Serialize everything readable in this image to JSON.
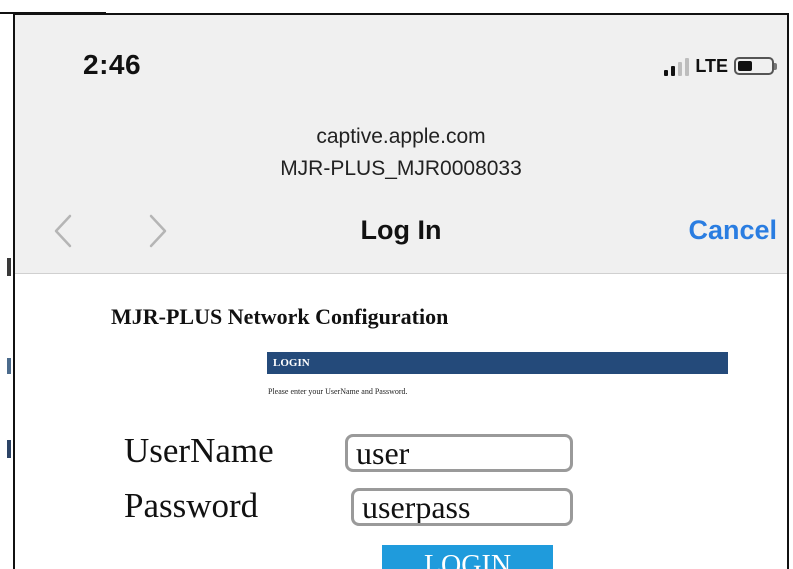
{
  "status_bar": {
    "time": "2:46",
    "network": "LTE",
    "signal_bars": 4,
    "signal_active": 2,
    "battery_level": 0.45
  },
  "browser": {
    "url": "captive.apple.com",
    "ssid": "MJR-PLUS_MJR0008033",
    "title": "Log In",
    "cancel_label": "Cancel",
    "back_icon": "chevron-left-icon",
    "forward_icon": "chevron-right-icon"
  },
  "page": {
    "heading": "MJR-PLUS Network Configuration",
    "section_bar": "LOGIN",
    "prompt": "Please enter your UserName and Password.",
    "username_label": "UserName",
    "username_value": "user",
    "password_label": "Password",
    "password_value": "userpass",
    "login_button": "LOGIN"
  },
  "colors": {
    "link_blue": "#2a7de1",
    "header_bar": "#244a7a",
    "button_blue": "#1f9bdc"
  }
}
